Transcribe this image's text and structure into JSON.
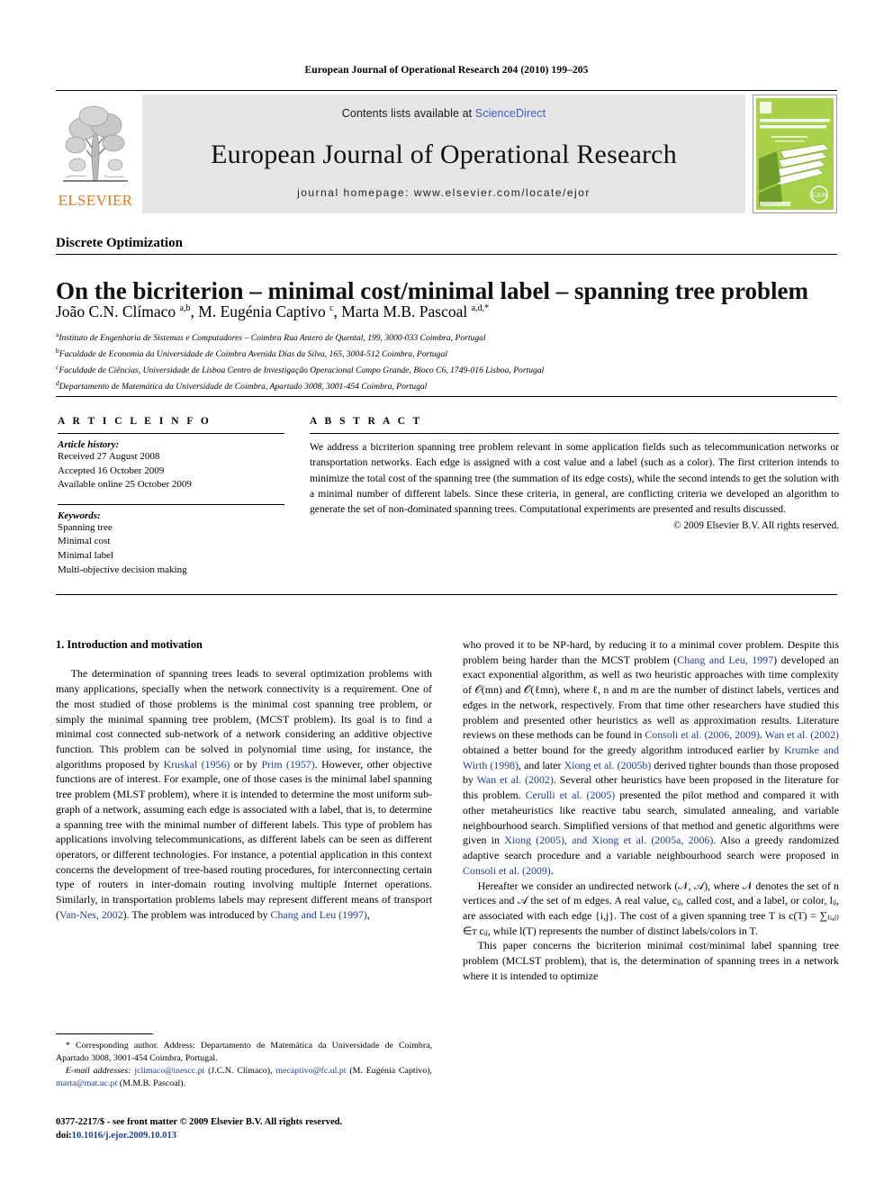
{
  "running_head": "European Journal of Operational Research 204 (2010) 199–205",
  "masthead": {
    "publisher_name": "ELSEVIER",
    "contents_prefix": "Contents lists available at ",
    "contents_link": "ScienceDirect",
    "journal_title": "European Journal of Operational Research",
    "homepage_line": "journal homepage: www.elsevier.com/locate/ejor",
    "cover_title_line1": "EUROPEAN JOURNAL OF",
    "cover_title_line2": "OPERATIONAL RESEARCH",
    "cover_badge": "EJOR",
    "accent_orange": "#E87722",
    "accent_blue": "#3a5fcd",
    "cover_green": "#8dc63f",
    "band_gray": "#e6e6e6"
  },
  "article": {
    "section_label": "Discrete Optimization",
    "title": "On the bicriterion – minimal cost/minimal label – spanning tree problem",
    "authors_html": "João C.N. Clímaco <sup>a,b</sup>, M. Eugénia Captivo <sup>c</sup>, Marta M.B. Pascoal <sup>a,d,</sup><sup>*</sup>",
    "affiliations": [
      {
        "marker": "a",
        "text": "Instituto de Engenharia de Sistemas e Computadores – Coimbra Rua Antero de Quental, 199, 3000-033 Coimbra, Portugal"
      },
      {
        "marker": "b",
        "text": "Faculdade de Economia da Universidade de Coimbra Avenida Dias da Silva, 165, 3004-512 Coimbra, Portugal"
      },
      {
        "marker": "c",
        "text": "Faculdade de Ciências, Universidade de Lisboa Centro de Investigação Operacional Campo Grande, Bloco C6, 1749-016 Lisboa, Portugal"
      },
      {
        "marker": "d",
        "text": "Departamento de Matemática da Universidade de Coimbra, Apartado 3008, 3001-454 Coimbra, Portugal"
      }
    ]
  },
  "article_info": {
    "heading": "A R T I C L E   I N F O",
    "history_heading": "Article history:",
    "history": [
      "Received 27 August 2008",
      "Accepted 16 October 2009",
      "Available online 25 October 2009"
    ],
    "keywords_heading": "Keywords:",
    "keywords": [
      "Spanning tree",
      "Minimal cost",
      "Minimal label",
      "Multi-objective decision making"
    ]
  },
  "abstract": {
    "heading": "A B S T R A C T",
    "text": "We address a bicriterion spanning tree problem relevant in some application fields such as telecommunication networks or transportation networks. Each edge is assigned with a cost value and a label (such as a color). The first criterion intends to minimize the total cost of the spanning tree (the summation of its edge costs), while the second intends to get the solution with a minimal number of different labels. Since these criteria, in general, are conflicting criteria we developed an algorithm to generate the set of non-dominated spanning trees. Computational experiments are presented and results discussed.",
    "copyright": "© 2009 Elsevier B.V. All rights reserved."
  },
  "body": {
    "section_heading": "1. Introduction and motivation",
    "left_paragraph_1_a": "The determination of spanning trees leads to several optimization problems with many applications, specially when the network connectivity is a requirement. One of the most studied of those problems is the minimal cost spanning tree problem, or simply the minimal spanning tree problem, (MCST problem). Its goal is to find a minimal cost connected sub-network of a network considering an additive objective function. This problem can be solved in polynomial time using, for instance, the algorithms proposed by ",
    "ref_kruskal": "Kruskal (1956)",
    "left_paragraph_1_b": " or by ",
    "ref_prim": "Prim (1957)",
    "left_paragraph_1_c": ". However, other objective functions are of interest. For example, one of those cases is the minimal label spanning tree problem (MLST problem), where it is intended to determine the most uniform sub-graph of a network, assuming each edge is associated with a label, that is, to determine a spanning tree with the minimal number of different labels. This type of problem has applications involving telecommunications, as different labels can be seen as different operators, or different technologies. For instance, a potential application in this context concerns the development of tree-based routing procedures, for interconnecting certain type of routers in inter-domain routing involving multiple Internet operations. Similarly, in transportation problems labels may represent different means of transport (",
    "ref_vannes": "Van-Nes, 2002",
    "left_paragraph_1_d": "). The problem was introduced by ",
    "ref_changleu_1": "Chang and Leu (1997)",
    "left_paragraph_1_e": ",",
    "right_paragraph_1_a": "who proved it to be NP-hard, by reducing it to a minimal cover problem. Despite this problem being harder than the MCST problem (",
    "ref_changleu_2": "Chang and Leu, 1997",
    "right_paragraph_1_b": ") developed an exact exponential algorithm, as well as two heuristic approaches with time complexity of 𝒪(mn) and 𝒪(ℓmn), where ℓ, n and m are the number of distinct labels, vertices and edges in the network, respectively. From that time other researchers have studied this problem and presented other heuristics as well as approximation results. Literature reviews on these methods can be found in ",
    "ref_consoli_1": "Consoli et al. (2006, 2009)",
    "right_paragraph_1_c": ". ",
    "ref_wan_1": "Wan et al. (2002)",
    "right_paragraph_1_d": " obtained a better bound for the greedy algorithm introduced earlier by ",
    "ref_krumke": "Krumke and Wirth (1998)",
    "right_paragraph_1_e": ", and later ",
    "ref_xiong_b": "Xiong et al. (2005b)",
    "right_paragraph_1_f": " derived tighter bounds than those proposed by ",
    "ref_wan_2": "Wan et al. (2002)",
    "right_paragraph_1_g": ". Several other heuristics have been proposed in the literature for this problem. ",
    "ref_cerulli": "Cerulli et al. (2005)",
    "right_paragraph_1_h": " presented the pilot method and compared it with other metaheuristics like reactive tabu search, simulated annealing, and variable neighbourhood search. Simplified versions of that method and genetic algorithms were given in ",
    "ref_xiong_2005": "Xiong (2005), and Xiong et al. (2005a, 2006)",
    "right_paragraph_1_i": ". Also a greedy randomized adaptive search procedure and a variable neighbourhood search were proposed in ",
    "ref_consoli_2": "Consoli et al. (2009)",
    "right_paragraph_1_j": ".",
    "right_paragraph_2": "Hereafter we consider an undirected network (𝒩, 𝒜), where 𝒩 denotes the set of n vertices and 𝒜 the set of m edges. A real value, cᵢⱼ, called cost, and a label, or color, lᵢⱼ, are associated with each edge {i,j}. The cost of a given spanning tree T is c(T) = ∑₍ᵢ,ⱼ₎∈ᴛ cᵢⱼ, while l(T) represents the number of distinct labels/colors in T.",
    "right_paragraph_3": "This paper concerns the bicriterion minimal cost/minimal label spanning tree problem (MCLST problem), that is, the determination of spanning trees in a network where it is intended to optimize"
  },
  "footnote": {
    "star": "*",
    "corresponding_text": " Corresponding author. Address: Departamento de Matemática da Universidade de Coimbra, Apartado 3008, 3001-454 Coimbra, Portugal.",
    "email_label": "E-mail addresses:",
    "email_1": "jclimaco@inescc.pt",
    "email_1_owner": " (J.C.N. Clímaco), ",
    "email_2": "mecaptivo@fc.ul.pt",
    "email_2_owner": " (M. Eugénia Captivo), ",
    "email_3": "marta@mat.uc.pt",
    "email_3_owner": " (M.M.B. Pascoal)."
  },
  "imprint": {
    "issn_line": "0377-2217/$ - see front matter © 2009 Elsevier B.V. All rights reserved.",
    "doi_prefix": "doi:",
    "doi": "10.1016/j.ejor.2009.10.013"
  }
}
